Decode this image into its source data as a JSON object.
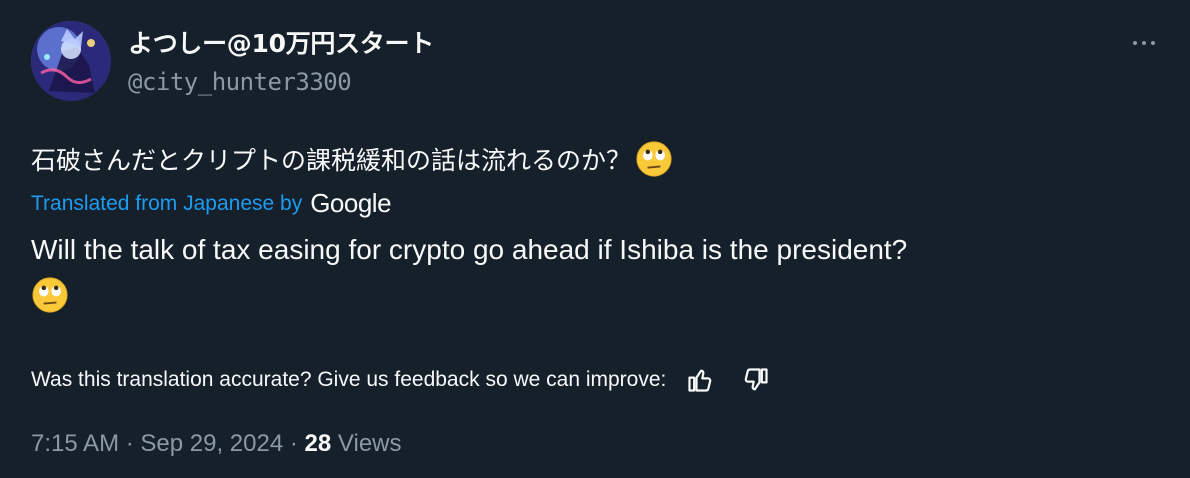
{
  "author": {
    "display_name": "よつしー@10万円スタート",
    "handle": "@city_hunter3300"
  },
  "tweet": {
    "original_text": "石破さんだとクリプトの課税緩和の話は流れるのか？",
    "emoji": "face-with-rolling-eyes",
    "translated_from_label": "Translated from Japanese by",
    "translator_brand": "Google",
    "translated_text": "Will the talk of tax easing for crypto go ahead if Ishiba is the president?"
  },
  "feedback": {
    "prompt": "Was this translation accurate? Give us feedback so we can improve:"
  },
  "meta": {
    "time": "7:15 AM",
    "separator": "·",
    "date": "Sep 29, 2024",
    "views_count": "28",
    "views_label": "Views"
  },
  "icons": {
    "more": "more-horizontal-icon",
    "thumbs_up": "thumbs-up-icon",
    "thumbs_down": "thumbs-down-icon"
  },
  "colors": {
    "background": "#15202b",
    "text_primary": "#f7f9f9",
    "text_secondary": "#8b98a5",
    "link": "#1d9bf0"
  }
}
